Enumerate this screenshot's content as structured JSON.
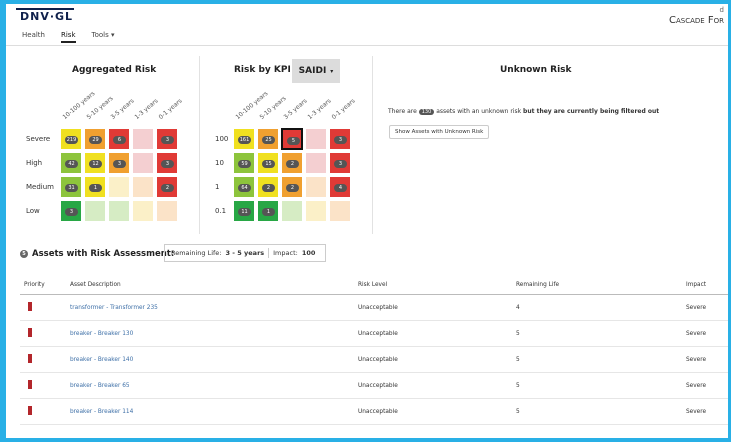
{
  "header": {
    "brand": "DNV·GL",
    "corp_label": "Cascade For",
    "corp_small": "d",
    "tabs": [
      {
        "label": "Health"
      },
      {
        "label": "Risk"
      },
      {
        "label": "Tools ▾"
      }
    ]
  },
  "aggregated": {
    "title": "Aggregated Risk",
    "col_labels": [
      "10-100 years",
      "5-10 years",
      "3-5 years",
      "1-3 years",
      "0-1 years"
    ],
    "row_labels": [
      "Severe",
      "High",
      "Medium",
      "Low"
    ],
    "cells": [
      [
        {
          "c": "#f0e020",
          "v": "219"
        },
        {
          "c": "#f0a030",
          "v": "29"
        },
        {
          "c": "#e03a36",
          "v": "6"
        },
        {
          "c": "#f4cfd1",
          "v": ""
        },
        {
          "c": "#e03a36",
          "v": "3"
        }
      ],
      [
        {
          "c": "#8dc43c",
          "v": "42"
        },
        {
          "c": "#f0e020",
          "v": "12"
        },
        {
          "c": "#f0a030",
          "v": "3"
        },
        {
          "c": "#f4cfd1",
          "v": ""
        },
        {
          "c": "#e03a36",
          "v": "3"
        }
      ],
      [
        {
          "c": "#8dc43c",
          "v": "31"
        },
        {
          "c": "#f0e020",
          "v": "1"
        },
        {
          "c": "#fbf0c8",
          "v": ""
        },
        {
          "c": "#fbe3c8",
          "v": ""
        },
        {
          "c": "#e03a36",
          "v": "2"
        }
      ],
      [
        {
          "c": "#28a745",
          "v": "3"
        },
        {
          "c": "#d6ecc4",
          "v": ""
        },
        {
          "c": "#d6ecc4",
          "v": ""
        },
        {
          "c": "#fbf0c8",
          "v": ""
        },
        {
          "c": "#fbe3c8",
          "v": ""
        }
      ]
    ]
  },
  "kpi": {
    "title": "Risk by KPI",
    "selected": "SAIDI",
    "col_labels": [
      "10-100 years",
      "5-10 years",
      "3-5 years",
      "1-3 years",
      "0-1 years"
    ],
    "row_labels": [
      "100",
      "10",
      "1",
      "0.1"
    ],
    "cells": [
      [
        {
          "c": "#f0e020",
          "v": "161"
        },
        {
          "c": "#f0a030",
          "v": "25"
        },
        {
          "c": "#e03a36",
          "v": "5"
        },
        {
          "c": "#f4cfd1",
          "v": ""
        },
        {
          "c": "#e03a36",
          "v": "3"
        }
      ],
      [
        {
          "c": "#8dc43c",
          "v": "59"
        },
        {
          "c": "#f0e020",
          "v": "15"
        },
        {
          "c": "#f0a030",
          "v": "2"
        },
        {
          "c": "#f4cfd1",
          "v": ""
        },
        {
          "c": "#e03a36",
          "v": "3"
        }
      ],
      [
        {
          "c": "#8dc43c",
          "v": "64"
        },
        {
          "c": "#f0e020",
          "v": "2"
        },
        {
          "c": "#f0a030",
          "v": "2"
        },
        {
          "c": "#fbe3c8",
          "v": ""
        },
        {
          "c": "#e03a36",
          "v": "4"
        }
      ],
      [
        {
          "c": "#28a745",
          "v": "11"
        },
        {
          "c": "#28a745",
          "v": "1"
        },
        {
          "c": "#d6ecc4",
          "v": ""
        },
        {
          "c": "#fbf0c8",
          "v": ""
        },
        {
          "c": "#fbe3c8",
          "v": ""
        }
      ]
    ]
  },
  "unknown": {
    "title": "Unknown Risk",
    "text_pre": "There are",
    "count": "130",
    "text_mid": "assets with an unknown risk",
    "text_post": "but they are currently being filtered out",
    "button": "Show Assets with Unknown Risk"
  },
  "assets": {
    "count": "5",
    "title": "Assets with Risk Assessment:",
    "filter_life_label": "Remaining Life:",
    "filter_life_value": "3 - 5 years",
    "filter_impact_label": "Impact:",
    "filter_impact_value": "100",
    "columns": [
      "Priority",
      "Asset Description",
      "Risk Level",
      "Remaining Life",
      "Impact"
    ],
    "rows": [
      {
        "desc": "transformer - Transformer 235",
        "risk": "Unacceptable",
        "life": "4",
        "impact": "Severe"
      },
      {
        "desc": "breaker - Breaker 130",
        "risk": "Unacceptable",
        "life": "5",
        "impact": "Severe"
      },
      {
        "desc": "breaker - Breaker 140",
        "risk": "Unacceptable",
        "life": "5",
        "impact": "Severe"
      },
      {
        "desc": "breaker - Breaker 65",
        "risk": "Unacceptable",
        "life": "5",
        "impact": "Severe"
      },
      {
        "desc": "breaker - Breaker 114",
        "risk": "Unacceptable",
        "life": "5",
        "impact": "Severe"
      }
    ]
  },
  "colors": {
    "priority": "#b3262b",
    "link": "#3d6fa7"
  }
}
